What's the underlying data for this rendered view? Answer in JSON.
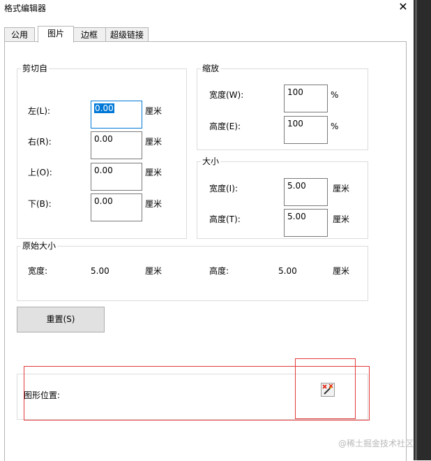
{
  "window": {
    "title": "格式编辑器",
    "close_glyph": "✕"
  },
  "tabs": [
    {
      "label": "公用",
      "active": false
    },
    {
      "label": "图片",
      "active": true
    },
    {
      "label": "边框",
      "active": false
    },
    {
      "label": "超级链接",
      "active": false
    }
  ],
  "crop": {
    "legend": "剪切自",
    "left": {
      "label": "左(L):",
      "value": "0.00",
      "unit": "厘米"
    },
    "right": {
      "label": "右(R):",
      "value": "0.00",
      "unit": "厘米"
    },
    "top": {
      "label": "上(O):",
      "value": "0.00",
      "unit": "厘米"
    },
    "bottom": {
      "label": "下(B):",
      "value": "0.00",
      "unit": "厘米"
    }
  },
  "scale": {
    "legend": "缩放",
    "width": {
      "label": "宽度(W):",
      "value": "100",
      "unit": "%"
    },
    "height": {
      "label": "高度(E):",
      "value": "100",
      "unit": "%"
    }
  },
  "size": {
    "legend": "大小",
    "width": {
      "label": "宽度(I):",
      "value": "5.00",
      "unit": "厘米"
    },
    "height": {
      "label": "高度(T):",
      "value": "5.00",
      "unit": "厘米"
    }
  },
  "original": {
    "legend": "原始大小",
    "width_label": "宽度:",
    "width_value": "5.00",
    "width_unit": "厘米",
    "height_label": "高度:",
    "height_value": "5.00",
    "height_unit": "厘米"
  },
  "reset_button": "重置(S)",
  "position": {
    "label": "图形位置:",
    "icon": "formula-wand-icon"
  },
  "watermark": "@稀土掘金技术社区",
  "colors": {
    "focus": "#0078d7",
    "annotation": "#e23a3a"
  }
}
